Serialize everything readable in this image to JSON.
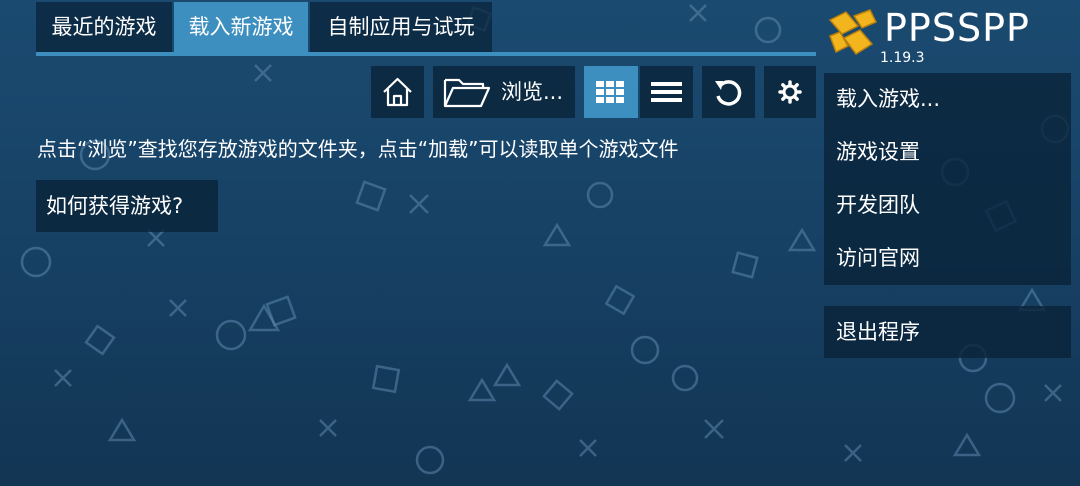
{
  "tabs": [
    {
      "label": "最近的游戏",
      "active": false
    },
    {
      "label": "载入新游戏",
      "active": true
    },
    {
      "label": "自制应用与试玩",
      "active": false
    }
  ],
  "toolbar": {
    "home_icon": "home-icon",
    "browse_label": "浏览...",
    "folder_icon": "folder-icon",
    "grid_icon": "grid-view-icon",
    "list_icon": "list-view-icon",
    "refresh_icon": "refresh-icon",
    "settings_icon": "gear-icon"
  },
  "main": {
    "hint": "点击“浏览”查找您存放游戏的文件夹，点击“加载”可以读取单个游戏文件",
    "how_to_button": "如何获得游戏?"
  },
  "logo": {
    "title": "PPSSPP",
    "version": "1.19.3"
  },
  "menu": {
    "items": [
      "载入游戏...",
      "游戏设置",
      "开发团队",
      "访问官网"
    ],
    "exit": "退出程序"
  },
  "colors": {
    "accent": "#3d8fbf",
    "panel": "#0a233a",
    "background": "#174266",
    "logo_yellow": "#f2b51d"
  }
}
